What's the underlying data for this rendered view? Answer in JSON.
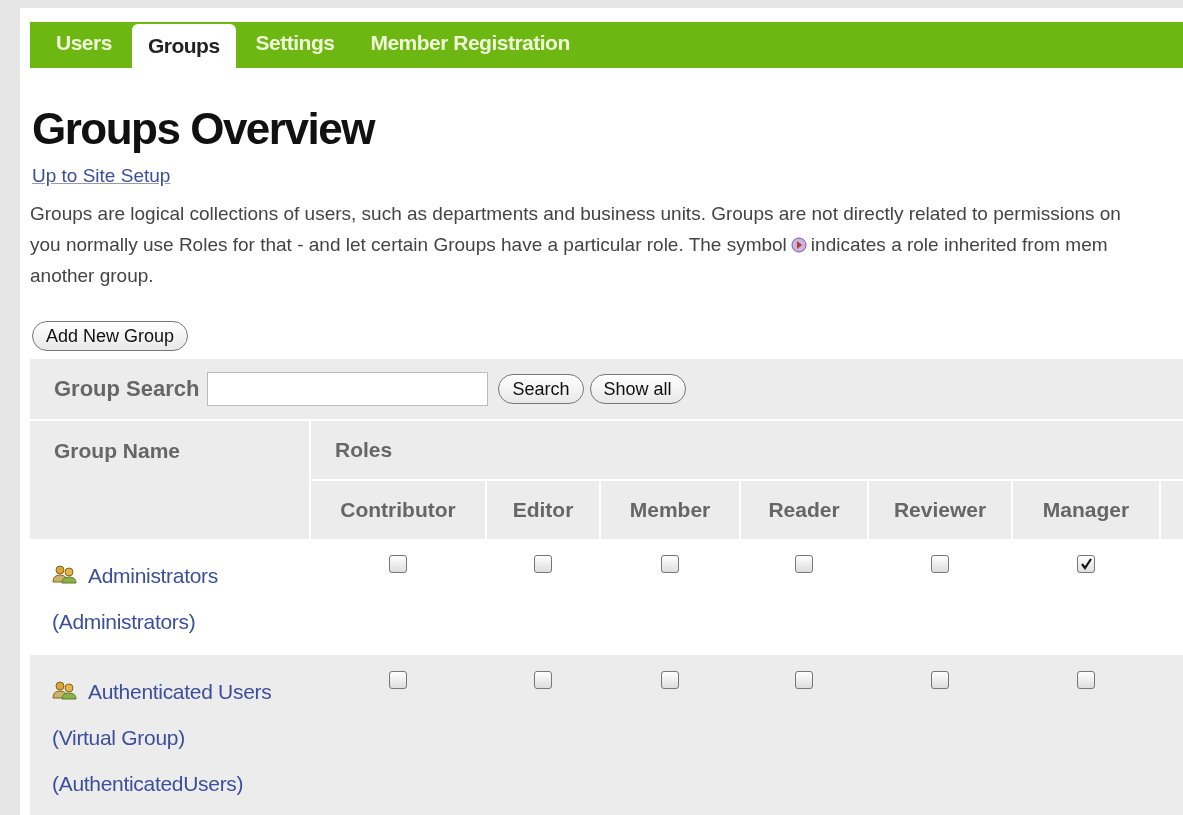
{
  "tabs": [
    {
      "label": "Users",
      "selected": false
    },
    {
      "label": "Groups",
      "selected": true
    },
    {
      "label": "Settings",
      "selected": false
    },
    {
      "label": "Member Registration",
      "selected": false
    }
  ],
  "title": "Groups Overview",
  "up_link": "Up to Site Setup",
  "description": {
    "line_1": "Groups are logical collections of users, such as departments and business units. Groups are not directly related to permissions on",
    "line_2_before": "you normally use Roles for that - and let certain Groups have a particular role. The symbol",
    "line_2_after": "indicates a role inherited from mem",
    "line_3": "another group."
  },
  "add_button": "Add New Group",
  "search": {
    "label": "Group Search",
    "buttons": [
      "Search",
      "Show all"
    ]
  },
  "table": {
    "name_column": "Group Name",
    "roles_heading": "Roles",
    "role_columns": [
      "Contributor",
      "Editor",
      "Member",
      "Reader",
      "Reviewer",
      "Manager"
    ],
    "rows": [
      {
        "name": "Administrators",
        "id": "(Administrators)",
        "roles": [
          {
            "checked": false
          },
          {
            "checked": false
          },
          {
            "checked": false
          },
          {
            "checked": false
          },
          {
            "checked": false
          },
          {
            "checked": true
          }
        ]
      },
      {
        "name": "Authenticated Users (Virtual Group)",
        "id": "(AuthenticatedUsers)",
        "roles": [
          {
            "checked": false
          },
          {
            "checked": false
          },
          {
            "checked": false
          },
          {
            "checked": false
          },
          {
            "checked": false
          },
          {
            "checked": false
          }
        ]
      }
    ]
  }
}
